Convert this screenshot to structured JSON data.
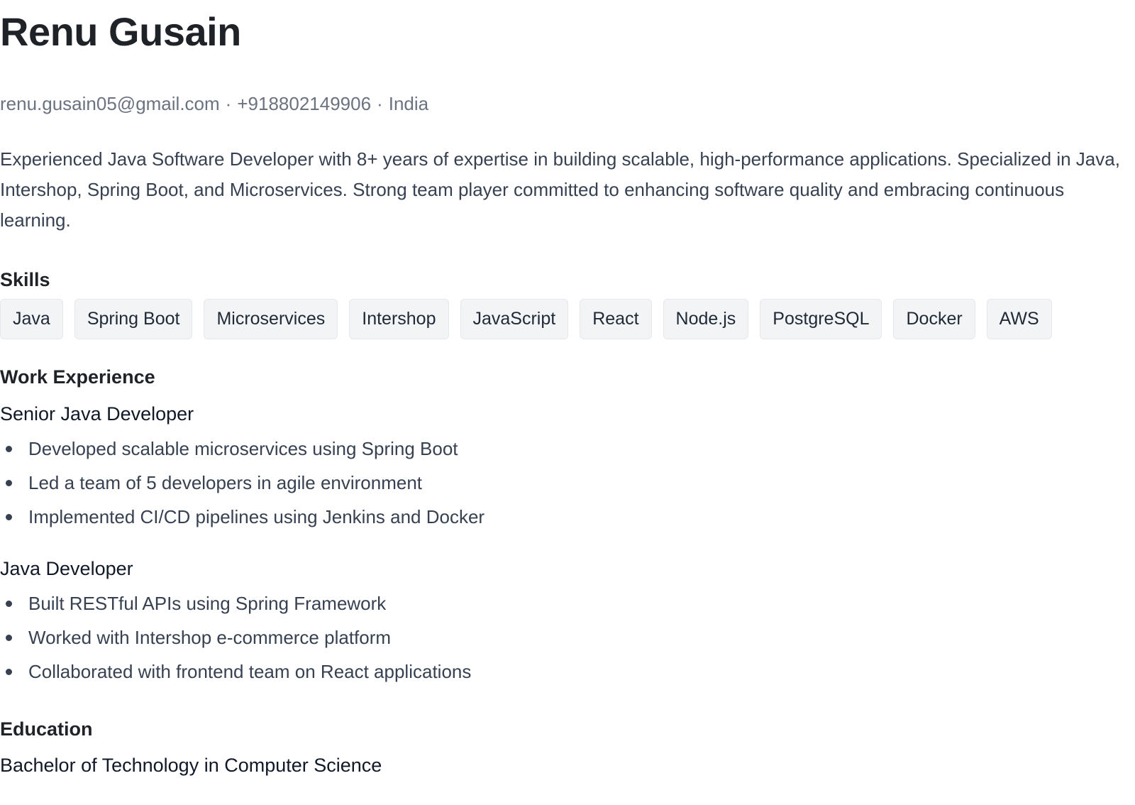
{
  "profile": {
    "name": "Renu Gusain",
    "email": "renu.gusain05@gmail.com",
    "phone": "+918802149906",
    "location": "India",
    "separator": "·",
    "summary": "Experienced Java Software Developer with 8+ years of expertise in building scalable, high-performance applications. Specialized in Java, Intershop, Spring Boot, and Microservices. Strong team player committed to enhancing software quality and embracing continuous learning."
  },
  "skills": {
    "heading": "Skills",
    "items": [
      "Java",
      "Spring Boot",
      "Microservices",
      "Intershop",
      "JavaScript",
      "React",
      "Node.js",
      "PostgreSQL",
      "Docker",
      "AWS"
    ]
  },
  "work": {
    "heading": "Work Experience",
    "jobs": [
      {
        "title": "Senior Java Developer",
        "bullets": [
          "Developed scalable microservices using Spring Boot",
          "Led a team of 5 developers in agile environment",
          "Implemented CI/CD pipelines using Jenkins and Docker"
        ]
      },
      {
        "title": "Java Developer",
        "bullets": [
          "Built RESTful APIs using Spring Framework",
          "Worked with Intershop e-commerce platform",
          "Collaborated with frontend team on React applications"
        ]
      }
    ]
  },
  "education": {
    "heading": "Education",
    "degree": "Bachelor of Technology in Computer Science"
  }
}
